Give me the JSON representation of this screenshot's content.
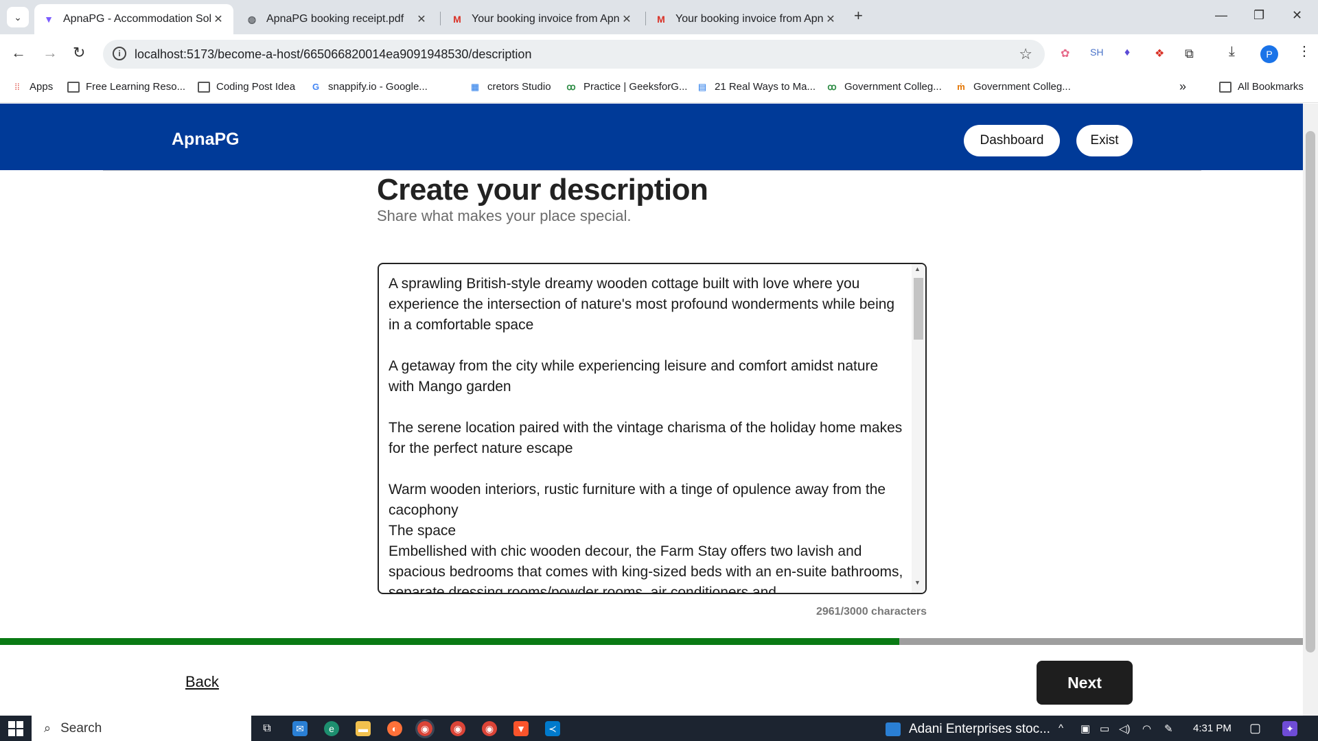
{
  "browser": {
    "tabs": [
      {
        "title": "ApnaPG - Accommodation Solu",
        "icon": "vite-icon",
        "active": true
      },
      {
        "title": "ApnaPG booking receipt.pdf",
        "icon": "globe-icon",
        "active": false
      },
      {
        "title": "Your booking invoice from Apn",
        "icon": "gmail-icon",
        "active": false
      },
      {
        "title": "Your booking invoice from Apn",
        "icon": "gmail-icon",
        "active": false
      }
    ],
    "url": "localhost:5173/become-a-host/665066820014ea9091948530/description",
    "extensions": [
      "SH"
    ],
    "profile_initial": "P"
  },
  "bookmarks": [
    {
      "label": "Apps"
    },
    {
      "label": "Free Learning Reso..."
    },
    {
      "label": "Coding Post Idea"
    },
    {
      "label": "snappify.io - Google..."
    },
    {
      "label": "cretors Studio"
    },
    {
      "label": "Practice | GeeksforG..."
    },
    {
      "label": "21 Real Ways to Ma..."
    },
    {
      "label": "Government Colleg..."
    },
    {
      "label": "Government Colleg..."
    },
    {
      "label": "All Bookmarks"
    }
  ],
  "header": {
    "logo": "ApnaPG",
    "dashboard": "Dashboard",
    "exit": "Exist"
  },
  "main": {
    "title": "Create your description",
    "subtitle": "Share what makes your place special.",
    "description": "A sprawling British-style dreamy wooden cottage built with love where you experience the intersection of nature's most profound wonderments while being in a comfortable space\n\nA getaway from the city while experiencing leisure and comfort amidst nature with Mango garden\n\nThe serene location paired with the vintage charisma of the holiday home makes for the perfect nature escape\n\nWarm wooden interiors, rustic furniture with a tinge of opulence away from the cacophony\nThe space\nEmbellished with chic wooden decour, the Farm Stay offers two lavish and spacious bedrooms that comes with king-sized beds with an en-suite bathrooms, separate dressing rooms/powder rooms, air conditioners and",
    "char_count": "2961/3000 characters",
    "progress": 0.69
  },
  "footer": {
    "back": "Back",
    "next": "Next"
  },
  "taskbar": {
    "search": "Search",
    "news": "Adani Enterprises stoc...",
    "time": "4:31 PM"
  },
  "colors": {
    "header_bg": "#003a98",
    "progress_fill": "#0a7a14",
    "progress_track": "#9e9e9e",
    "next_bg": "#1e1e1e"
  }
}
